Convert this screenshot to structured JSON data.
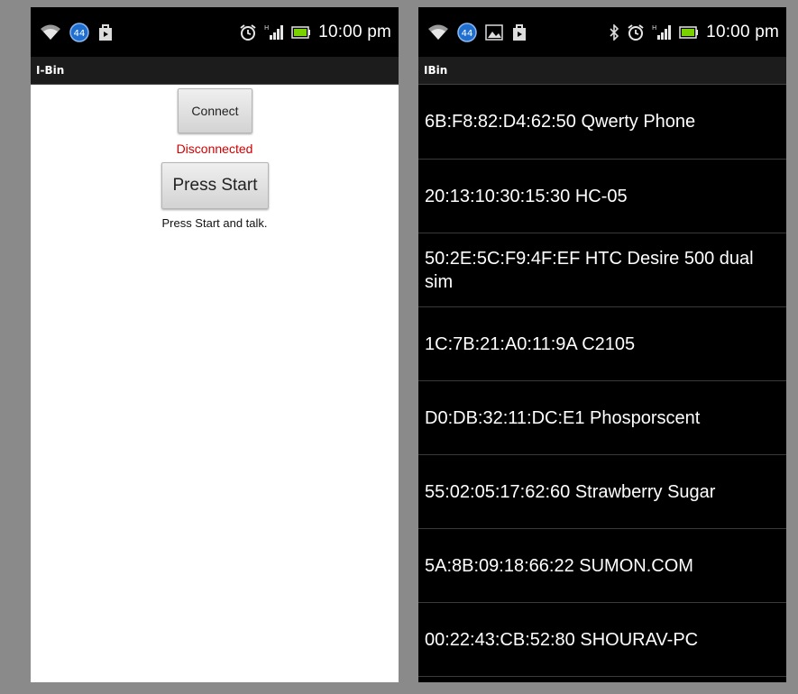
{
  "left_screen": {
    "status_bar": {
      "icons_left": [
        "wifi-icon",
        "circle-44-icon",
        "bag-icon"
      ],
      "badge_number": "44",
      "icons_right": [
        "alarm-icon",
        "signal-icon",
        "battery-icon"
      ],
      "time": "10:00 pm"
    },
    "app_title": "I-Bin",
    "connect_label": "Connect",
    "status_text": "Disconnected",
    "start_label": "Press Start",
    "hint_text": "Press Start and talk."
  },
  "right_screen": {
    "status_bar": {
      "icons_left": [
        "wifi-icon",
        "circle-44-icon",
        "image-icon",
        "bag-icon"
      ],
      "badge_number": "44",
      "icons_right": [
        "bluetooth-icon",
        "alarm-icon",
        "signal-icon",
        "battery-icon"
      ],
      "time": "10:00 pm"
    },
    "app_title": "IBin",
    "devices": [
      "6B:F8:82:D4:62:50 Qwerty Phone",
      "20:13:10:30:15:30 HC-05",
      "50:2E:5C:F9:4F:EF HTC Desire 500 dual sim",
      "1C:7B:21:A0:11:9A C2105",
      "D0:DB:32:11:DC:E1 Phosporscent",
      "55:02:05:17:62:60 Strawberry Sugar",
      "5A:8B:09:18:66:22 SUMON.COM",
      "00:22:43:CB:52:80 SHOURAV-PC"
    ]
  },
  "colors": {
    "status_disconnected": "#d10000",
    "background_frame": "#8a8a8a"
  }
}
